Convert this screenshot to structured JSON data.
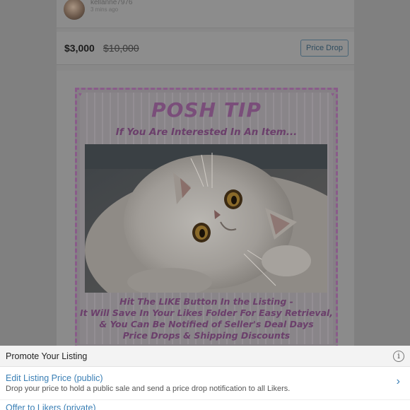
{
  "seller": {
    "username": "kellanne7976",
    "posted_time": "3 mins ago"
  },
  "price": {
    "current": "$3,000",
    "original": "$10,000",
    "price_drop_label": "Price Drop"
  },
  "listing_image": {
    "title": "POSH TIP",
    "subtitle": "If You Are Interested In An Item...",
    "body_lines": [
      "Hit The LIKE Button In the Listing -",
      "It Will Save In Your Likes Folder For Easy Retrieval,",
      "& You Can Be Notified of Seller's Deal Days",
      "Price Drops & Shipping Discounts"
    ]
  },
  "promote_sheet": {
    "title": "Promote Your Listing",
    "info_icon": "i",
    "options": [
      {
        "title": "Edit Listing Price (public)",
        "description": "Drop your price to hold a public sale and send a price drop notification to all Likers.",
        "chevron": "›"
      },
      {
        "title": "Offer to Likers (private)"
      }
    ]
  },
  "colors": {
    "overlay": "#808080",
    "link": "#3a7fb5",
    "tip_purple": "#6b3f6b"
  }
}
